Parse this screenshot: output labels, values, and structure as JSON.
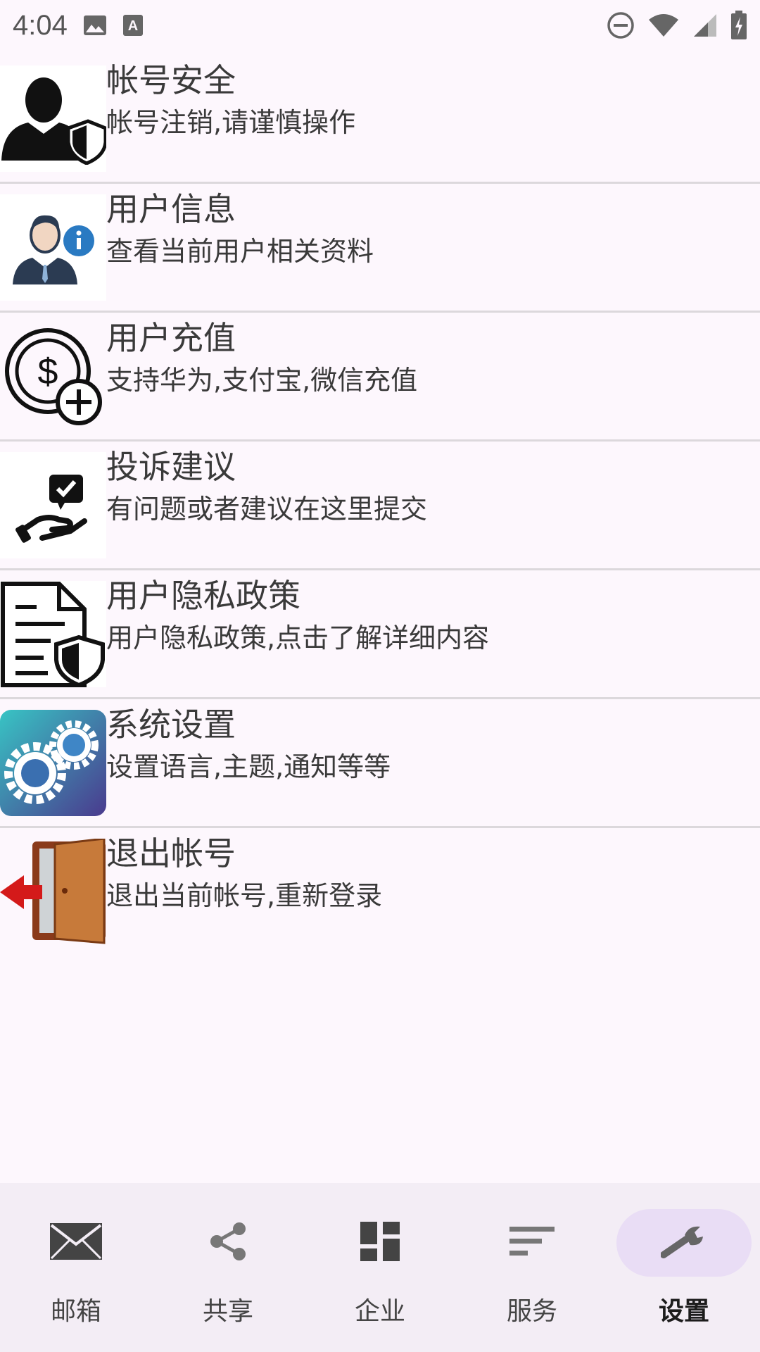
{
  "status_bar": {
    "time": "4:04",
    "icons": [
      "image-icon",
      "keyboard-a-icon",
      "do-not-disturb-icon",
      "wifi-icon",
      "signal-icon",
      "battery-charging-icon"
    ]
  },
  "settings": {
    "items": [
      {
        "icon": "account-security-icon",
        "title": "帐号安全",
        "subtitle": "帐号注销,请谨慎操作"
      },
      {
        "icon": "user-info-icon",
        "title": "用户信息",
        "subtitle": "查看当前用户相关资料"
      },
      {
        "icon": "recharge-icon",
        "title": "用户充值",
        "subtitle": "支持华为,支付宝,微信充值"
      },
      {
        "icon": "feedback-icon",
        "title": "投诉建议",
        "subtitle": "有问题或者建议在这里提交"
      },
      {
        "icon": "privacy-policy-icon",
        "title": "用户隐私政策",
        "subtitle": "用户隐私政策,点击了解详细内容"
      },
      {
        "icon": "system-settings-icon",
        "title": "系统设置",
        "subtitle": "设置语言,主题,通知等等"
      },
      {
        "icon": "logout-icon",
        "title": "退出帐号",
        "subtitle": "退出当前帐号,重新登录"
      }
    ]
  },
  "bottom_nav": {
    "items": [
      {
        "icon": "mail-icon",
        "label": "邮箱",
        "active": false
      },
      {
        "icon": "share-icon",
        "label": "共享",
        "active": false
      },
      {
        "icon": "dashboard-icon",
        "label": "企业",
        "active": false
      },
      {
        "icon": "sort-icon",
        "label": "服务",
        "active": false
      },
      {
        "icon": "wrench-icon",
        "label": "设置",
        "active": true
      }
    ]
  },
  "colors": {
    "background": "#fdf7fd",
    "nav_background": "#f3edf5",
    "nav_active_pill": "#e9ddf5",
    "divider": "#dcd8dc"
  }
}
